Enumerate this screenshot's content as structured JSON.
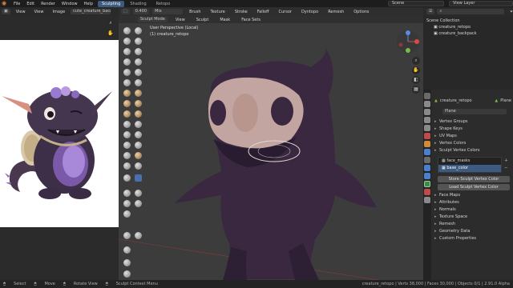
{
  "menu": [
    "File",
    "Edit",
    "Render",
    "Window",
    "Help"
  ],
  "workspace_tabs": [
    "Sculpting",
    "Shading",
    "Retopo"
  ],
  "active_tab": "Sculpting",
  "scene_label": "Scene",
  "view_layer_label": "View Layer",
  "image_editor": {
    "menus": [
      "View",
      "View",
      "Image"
    ],
    "image_name": "cute_creature_backpack"
  },
  "viewport": {
    "mode": "Sculpt Mode",
    "menus": [
      "View",
      "Sculpt",
      "Mask",
      "Face Sets"
    ],
    "header_fields": [
      "0.400",
      "Mix",
      "Brush",
      "Texture",
      "Stroke",
      "Falloff",
      "Cursor",
      "Dyntopo",
      "Remesh",
      "Options"
    ],
    "overlay_title": "User Perspective (Local)",
    "overlay_object": "(1) creature_retopo"
  },
  "outliner": {
    "title": "Scene Collection",
    "items": [
      "creature_retopo",
      "creature_backpack"
    ]
  },
  "properties": {
    "object_name": "creature_retopo",
    "object_type": "Plane",
    "data_name": "Plane",
    "panels_top": [
      "Vertex Groups",
      "Shape Keys",
      "UV Maps",
      "Vertex Colors",
      "Sculpt Vertex Colors"
    ],
    "color_layers": [
      "face_masks",
      "base_color"
    ],
    "buttons": [
      "Store Sculpt Vertex Color",
      "Load Sculpt Vertex Color"
    ],
    "panels_bottom": [
      "Face Maps",
      "Attributes",
      "Normals",
      "Texture Space",
      "Remesh",
      "Geometry Data",
      "Custom Properties"
    ]
  },
  "status_bar": {
    "left": [
      "Select",
      "Move",
      "Rotate View",
      "Sculpt Context Menu"
    ],
    "right": "creature_retopo | Verts 38,000 | Faces 30,000 | Objects 0/1 | 2.91.0 Alpha"
  },
  "colors": {
    "accent": "#3d5a80",
    "creature_body": "#3a2a3a",
    "creature_face": "#c9a9a0",
    "viewport_bg": "#3c3c3c"
  }
}
